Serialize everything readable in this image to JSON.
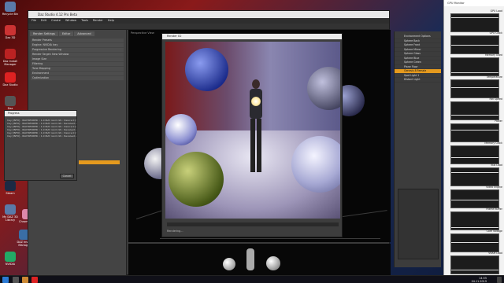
{
  "desktop": {
    "icons": [
      {
        "label": "Recycle Bin",
        "icon": "recycle-bin-icon",
        "color": "#5a7aa8"
      },
      {
        "label": "Daz 3D",
        "icon": "daz-icon",
        "color": "#c33"
      },
      {
        "label": "Daz Install Manager",
        "icon": "install-manager-icon",
        "color": "#b22"
      },
      {
        "label": "Daz Studio",
        "icon": "studio-icon",
        "color": "#d22"
      },
      {
        "label": "Daz Connect",
        "icon": "connect-icon",
        "color": "#555"
      },
      {
        "label": "Steam",
        "icon": "steam-icon",
        "color": "#1c2a44"
      },
      {
        "label": "My DAZ 3D Library",
        "icon": "library-icon",
        "color": "#5a7aa8"
      },
      {
        "label": "DAZ Install Manager",
        "icon": "install-icon",
        "color": "#3a6ea5"
      },
      {
        "label": "ChromeBurn",
        "icon": "avatar-icon",
        "color": "#d8a"
      },
      {
        "label": "NVIDIA",
        "icon": "nvidia-icon",
        "color": "#2a6"
      }
    ]
  },
  "app": {
    "title": "Daz Studio 4.12 Pro Beta",
    "menu": [
      "File",
      "Edit",
      "Create",
      "Window",
      "Tools",
      "Render",
      "Help"
    ],
    "left_tabs": [
      "Render Settings",
      "Editor",
      "Advanced"
    ],
    "left_rows": [
      "Render Presets",
      "Engine: NVIDIA Iray",
      "Progressive Rendering",
      "Render Target: New Window",
      "Image Size",
      "Filtering",
      "Tone Mapping",
      "Environment",
      "Optimization"
    ],
    "viewport_label": "Perspective View",
    "render_window_title": "Render 02",
    "render_window_status": "Rendering...",
    "bottom_label": "Iteration"
  },
  "scene": {
    "items": [
      "Environment Options",
      "Sphere Back",
      "Sphere Front",
      "Sphere Mirror",
      "Sphere Glass",
      "Sphere Blue",
      "Sphere Green",
      "Plane Floor",
      "Genesis 8 Female",
      "Spot Light 1",
      "Distant Light"
    ],
    "selected_index": 8
  },
  "log_dialog": {
    "title": "Progress",
    "lines": [
      "Iray [INFO] - IRAY:RENDER :: 1.0 IRAY rend info : Device 0 (GeForce RTX 2080 Ti): 4 iter",
      "Iray [INFO] - IRAY:RENDER :: 1.0 IRAY rend info : Received update to 00032 iterations",
      "Iray [INFO] - IRAY:RENDER :: 1.0 IRAY rend info : Device 0 (GeForce RTX 2080 Ti): 8 iter",
      "Iray [INFO] - IRAY:RENDER :: 1.0 IRAY rend info : Received update to 00064 iterations",
      "Iray [INFO] - IRAY:RENDER :: 1.0 IRAY rend info : Device 0 (GeForce RTX 2080 Ti): 16 iter",
      "Iray [INFO] - IRAY:RENDER :: 1.0 IRAY rend info : Received update to 00128 iterations"
    ],
    "cancel_label": "Cancel"
  },
  "gpu_monitor": {
    "title": "GPU Monitor",
    "graphs": [
      "GPU Load",
      "GPU Clock",
      "Memory Used",
      "Temperature",
      "Fan Speed",
      "Power",
      "Memory Clock",
      "Bus Load",
      "Video Engine",
      "Frame Buffer",
      "Core Voltage",
      "VRAM Load"
    ]
  },
  "taskbar": {
    "time": "14:55",
    "date": "04.11.2019"
  },
  "colors": {
    "accent": "#e59a1e",
    "panel": "#3c3c3c"
  }
}
